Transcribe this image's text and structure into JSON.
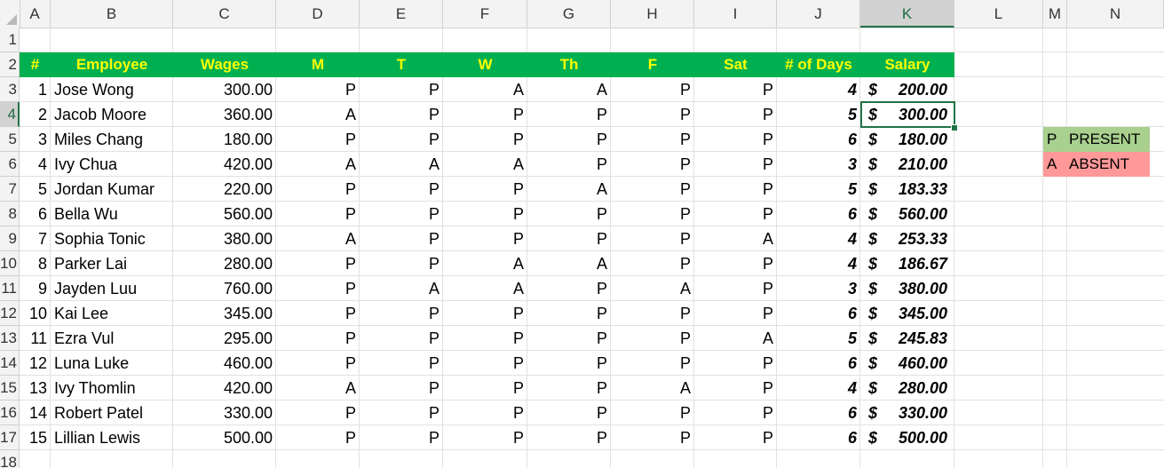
{
  "columns": [
    "A",
    "B",
    "C",
    "D",
    "E",
    "F",
    "G",
    "H",
    "I",
    "J",
    "K",
    "L",
    "M",
    "N"
  ],
  "selected_column": "K",
  "row_numbers": [
    "1",
    "2",
    "3",
    "4",
    "5",
    "6",
    "7",
    "8",
    "9",
    "10",
    "11",
    "12",
    "13",
    "14",
    "15",
    "16",
    "17",
    "18"
  ],
  "selected_row": "4",
  "header": {
    "num": "#",
    "employee": "Employee",
    "wages": "Wages",
    "days": [
      "M",
      "T",
      "W",
      "Th",
      "F",
      "Sat"
    ],
    "num_days": "# of Days",
    "salary": "Salary"
  },
  "rows": [
    {
      "num": "1",
      "name": "Jose Wong",
      "wages": "300.00",
      "att": [
        "P",
        "P",
        "A",
        "A",
        "P",
        "P"
      ],
      "days": "4",
      "salary": "200.00"
    },
    {
      "num": "2",
      "name": "Jacob Moore",
      "wages": "360.00",
      "att": [
        "A",
        "P",
        "P",
        "P",
        "P",
        "P"
      ],
      "days": "5",
      "salary": "300.00"
    },
    {
      "num": "3",
      "name": "Miles Chang",
      "wages": "180.00",
      "att": [
        "P",
        "P",
        "P",
        "P",
        "P",
        "P"
      ],
      "days": "6",
      "salary": "180.00"
    },
    {
      "num": "4",
      "name": "Ivy Chua",
      "wages": "420.00",
      "att": [
        "A",
        "A",
        "A",
        "P",
        "P",
        "P"
      ],
      "days": "3",
      "salary": "210.00"
    },
    {
      "num": "5",
      "name": "Jordan Kumar",
      "wages": "220.00",
      "att": [
        "P",
        "P",
        "P",
        "A",
        "P",
        "P"
      ],
      "days": "5",
      "salary": "183.33"
    },
    {
      "num": "6",
      "name": "Bella Wu",
      "wages": "560.00",
      "att": [
        "P",
        "P",
        "P",
        "P",
        "P",
        "P"
      ],
      "days": "6",
      "salary": "560.00"
    },
    {
      "num": "7",
      "name": "Sophia Tonic",
      "wages": "380.00",
      "att": [
        "A",
        "P",
        "P",
        "P",
        "P",
        "A"
      ],
      "days": "4",
      "salary": "253.33"
    },
    {
      "num": "8",
      "name": "Parker Lai",
      "wages": "280.00",
      "att": [
        "P",
        "P",
        "A",
        "A",
        "P",
        "P"
      ],
      "days": "4",
      "salary": "186.67"
    },
    {
      "num": "9",
      "name": "Jayden Luu",
      "wages": "760.00",
      "att": [
        "P",
        "A",
        "A",
        "P",
        "A",
        "P"
      ],
      "days": "3",
      "salary": "380.00"
    },
    {
      "num": "10",
      "name": "Kai Lee",
      "wages": "345.00",
      "att": [
        "P",
        "P",
        "P",
        "P",
        "P",
        "P"
      ],
      "days": "6",
      "salary": "345.00"
    },
    {
      "num": "11",
      "name": "Ezra Vul",
      "wages": "295.00",
      "att": [
        "P",
        "P",
        "P",
        "P",
        "P",
        "A"
      ],
      "days": "5",
      "salary": "245.83"
    },
    {
      "num": "12",
      "name": "Luna Luke",
      "wages": "460.00",
      "att": [
        "P",
        "P",
        "P",
        "P",
        "P",
        "P"
      ],
      "days": "6",
      "salary": "460.00"
    },
    {
      "num": "13",
      "name": "Ivy Thomlin",
      "wages": "420.00",
      "att": [
        "A",
        "P",
        "P",
        "P",
        "A",
        "P"
      ],
      "days": "4",
      "salary": "280.00"
    },
    {
      "num": "14",
      "name": "Robert Patel",
      "wages": "330.00",
      "att": [
        "P",
        "P",
        "P",
        "P",
        "P",
        "P"
      ],
      "days": "6",
      "salary": "330.00"
    },
    {
      "num": "15",
      "name": "Lillian Lewis",
      "wages": "500.00",
      "att": [
        "P",
        "P",
        "P",
        "P",
        "P",
        "P"
      ],
      "days": "6",
      "salary": "500.00"
    }
  ],
  "currency_symbol": "$",
  "legend": [
    {
      "code": "P",
      "label": "PRESENT",
      "color": "#a9d08e"
    },
    {
      "code": "A",
      "label": "ABSENT",
      "color": "#ff9999"
    }
  ],
  "colors": {
    "header_fill": "#00b050",
    "header_text": "#ffff00",
    "selection": "#217346"
  }
}
